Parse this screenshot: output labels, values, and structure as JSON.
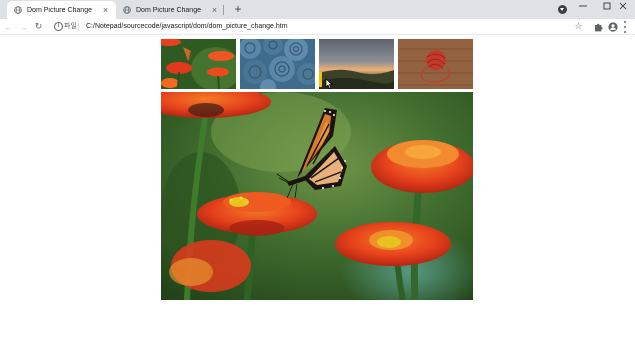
{
  "browser": {
    "tabs": [
      {
        "title": "Dom Picture Change",
        "close": "×"
      },
      {
        "title": "Dom Picture Change",
        "close": "×"
      }
    ],
    "new_tab": "+",
    "address": {
      "protocol_label": "파일",
      "url": "C:/Notepad/sourcecode/javascript/dom/dom_picture_change.htm"
    },
    "window_controls": {
      "minimize": "–",
      "maximize": "□",
      "close": "×"
    },
    "nav": {
      "back": "←",
      "forward": "→",
      "reload": "↻"
    },
    "bookmark": "☆"
  },
  "page": {
    "thumbnails": [
      {
        "name": "butterfly-flowers-thumbnail",
        "subject": "butterfly on red flowers"
      },
      {
        "name": "blue-roses-thumbnail",
        "subject": "blue fabric roses"
      },
      {
        "name": "sunset-landscape-thumbnail",
        "subject": "sunset over hills"
      },
      {
        "name": "red-yarn-thumbnail",
        "subject": "red yarn ball on wood"
      }
    ],
    "main_image": {
      "subject": "monarch butterfly on red zinnia flowers"
    }
  },
  "colors": {
    "tabstrip": "#dee1e6",
    "flower_red": "#e2381c",
    "flower_orange": "#f26a1f",
    "foliage_green": "#3d6b2c",
    "wood": "#8a5a3a"
  }
}
